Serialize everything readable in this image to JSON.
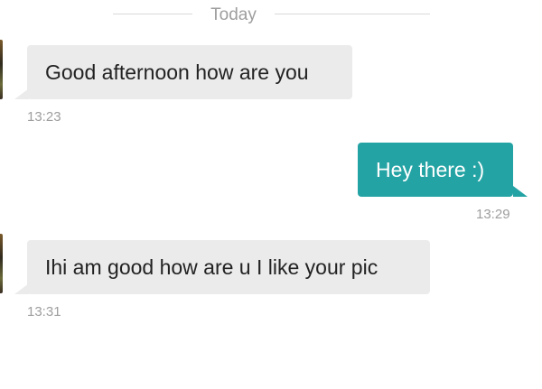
{
  "header": {
    "date_label": "Today"
  },
  "messages": [
    {
      "direction": "incoming",
      "text": "Good afternoon how are you",
      "time": "13:23"
    },
    {
      "direction": "outgoing",
      "text": "Hey there :)",
      "time": "13:29"
    },
    {
      "direction": "incoming",
      "text": "Ihi am good how are u I like your pic",
      "time": "13:31"
    }
  ],
  "colors": {
    "incoming_bubble": "#ebebeb",
    "outgoing_bubble": "#24a3a4",
    "timestamp": "#9e9e9e"
  }
}
